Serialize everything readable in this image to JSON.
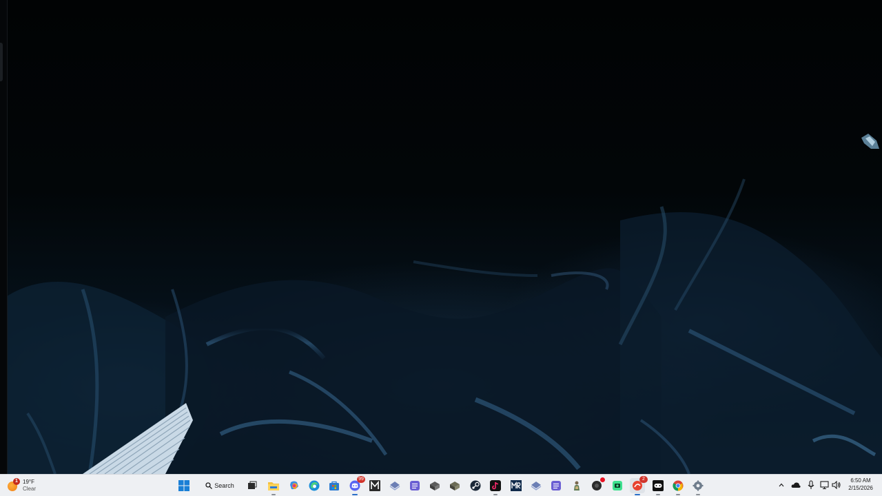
{
  "taskbar": {
    "weather": {
      "temperature": "19°F",
      "condition": "Clear",
      "badge": "1"
    },
    "search_label": "Search",
    "pinned_apps": [
      {
        "name": "start-button",
        "badge": ""
      },
      {
        "name": "task-view",
        "badge": ""
      },
      {
        "name": "file-explorer",
        "badge": ""
      },
      {
        "name": "copilot",
        "badge": ""
      },
      {
        "name": "edge",
        "badge": ""
      },
      {
        "name": "microsoft-store",
        "badge": ""
      },
      {
        "name": "discord",
        "badge": "99"
      },
      {
        "name": "app-m",
        "badge": ""
      },
      {
        "name": "app-diamond",
        "badge": ""
      },
      {
        "name": "app-notepad",
        "badge": ""
      },
      {
        "name": "app-box",
        "badge": ""
      },
      {
        "name": "app-box-2",
        "badge": ""
      },
      {
        "name": "steam",
        "badge": ""
      },
      {
        "name": "tiktok",
        "badge": ""
      },
      {
        "name": "app-mr",
        "badge": ""
      },
      {
        "name": "app-diamond-2",
        "badge": ""
      },
      {
        "name": "app-notepad-2",
        "badge": ""
      },
      {
        "name": "app-figure",
        "badge": ""
      },
      {
        "name": "app-record",
        "badge": ""
      },
      {
        "name": "app-cam",
        "badge": ""
      },
      {
        "name": "app-red-active",
        "badge": "2"
      },
      {
        "name": "app-game",
        "badge": ""
      },
      {
        "name": "chrome",
        "badge": ""
      },
      {
        "name": "settings",
        "badge": ""
      }
    ],
    "clock": {
      "time": "6:50 AM",
      "date": "2/15/2026"
    }
  },
  "colors": {
    "taskbar_bg": "#eef0f3",
    "accent": "#2b6fc8",
    "badge_red": "#d1342b"
  }
}
